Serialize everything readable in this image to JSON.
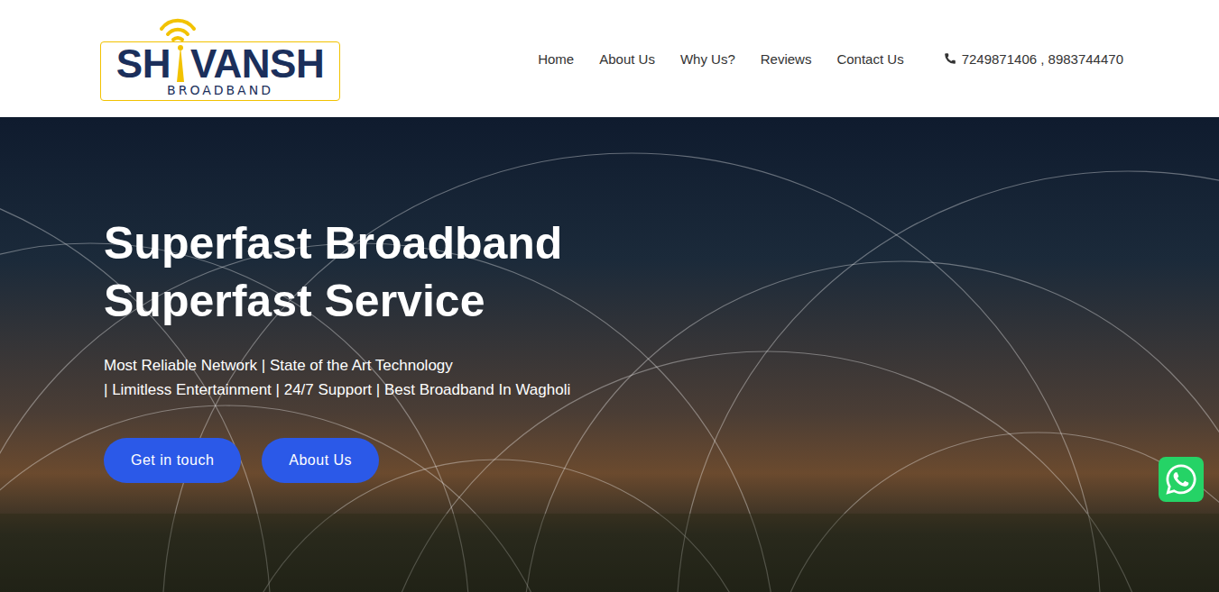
{
  "logo": {
    "left": "SH",
    "right": "VANSH",
    "tagline": "BROADBAND"
  },
  "nav": {
    "items": [
      {
        "label": "Home"
      },
      {
        "label": "About Us"
      },
      {
        "label": "Why Us?"
      },
      {
        "label": "Reviews"
      },
      {
        "label": "Contact Us"
      }
    ],
    "phone": "7249871406 , 8983744470"
  },
  "hero": {
    "title_lines": [
      "Superfast Broadband",
      "Superfast Service"
    ],
    "subtitle_lines": [
      "Most Reliable Network | State of the Art Technology",
      "| Limitless Entertainment | 24/7 Support | Best Broadband In Wagholi"
    ],
    "buttons": [
      "Get in touch",
      "About Us"
    ]
  }
}
